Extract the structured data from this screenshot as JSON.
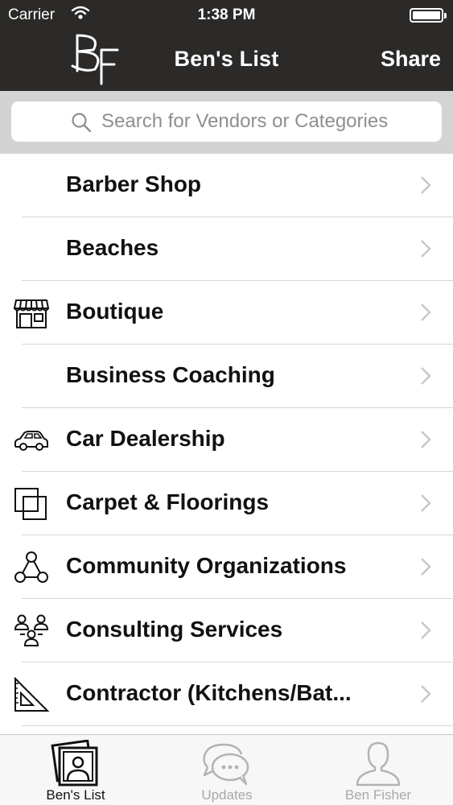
{
  "status_bar": {
    "carrier": "Carrier",
    "time": "1:38 PM"
  },
  "nav": {
    "title": "Ben's List",
    "share_label": "Share",
    "logo_icon": "bf-logo"
  },
  "search": {
    "placeholder": "Search for Vendors or Categories",
    "icon": "search-icon"
  },
  "list": {
    "items": [
      {
        "label": "Barber Shop",
        "icon": ""
      },
      {
        "label": "Beaches",
        "icon": ""
      },
      {
        "label": "Boutique",
        "icon": "storefront-icon"
      },
      {
        "label": "Business Coaching",
        "icon": ""
      },
      {
        "label": "Car Dealership",
        "icon": "car-icon"
      },
      {
        "label": "Carpet & Floorings",
        "icon": "squares-icon"
      },
      {
        "label": "Community Organizations",
        "icon": "network-icon"
      },
      {
        "label": "Consulting Services",
        "icon": "people-icon"
      },
      {
        "label": "Contractor (Kitchens/Bat...",
        "icon": "set-square-icon"
      }
    ]
  },
  "tabbar": {
    "tabs": [
      {
        "label": "Ben's List",
        "icon": "photos-icon",
        "active": true
      },
      {
        "label": "Updates",
        "icon": "chat-bubbles-icon",
        "active": false
      },
      {
        "label": "Ben Fisher",
        "icon": "person-icon",
        "active": false
      }
    ]
  },
  "colors": {
    "header_bg": "#2b2a28",
    "search_bg": "#d3d3d3",
    "tab_inactive": "#a8a8a8"
  }
}
